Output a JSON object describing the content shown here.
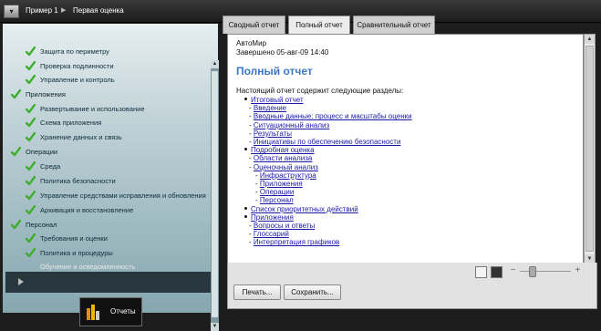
{
  "breadcrumb": {
    "menu_icon": "chevron-down-icon",
    "item1": "Пример 1",
    "item2": "Первая оценка",
    "sep": "▶"
  },
  "nav": {
    "items": [
      {
        "label": "Защита по периметру",
        "checked": true,
        "level": 2
      },
      {
        "label": "Проверка подлинности",
        "checked": true,
        "level": 2
      },
      {
        "label": "Управление и контроль",
        "checked": true,
        "level": 2
      },
      {
        "label": "Приложения",
        "checked": true,
        "level": 1
      },
      {
        "label": "Развертывание и использование",
        "checked": true,
        "level": 2
      },
      {
        "label": "Схема приложения",
        "checked": true,
        "level": 2
      },
      {
        "label": "Хранение данных и связь",
        "checked": true,
        "level": 2
      },
      {
        "label": "Операции",
        "checked": true,
        "level": 1
      },
      {
        "label": "Среда",
        "checked": true,
        "level": 2
      },
      {
        "label": "Политика безопасности",
        "checked": true,
        "level": 2
      },
      {
        "label": "Управление средствами исправления и обновления",
        "checked": true,
        "level": 2
      },
      {
        "label": "Архивация и восстановление",
        "checked": true,
        "level": 2
      },
      {
        "label": "Персонал",
        "checked": true,
        "level": 1
      },
      {
        "label": "Требования и оценки",
        "checked": true,
        "level": 2
      },
      {
        "label": "Политика и процедуры",
        "checked": true,
        "level": 2
      },
      {
        "label": "Обучение и осведомленность",
        "checked": false,
        "level": 2,
        "selected": true
      }
    ],
    "reports_button": "Отчеты"
  },
  "tabs": [
    "Сводный отчет",
    "Полный отчет",
    "Сравнительный отчет"
  ],
  "document": {
    "company": "АвтоМир",
    "completed": "Завершено 05-авг-09 14:40",
    "title": "Полный отчет",
    "intro": "Настоящий отчет содержит следующие разделы:",
    "toc": [
      {
        "text": "Итоговый отчет",
        "level": 1
      },
      {
        "text": "Введение",
        "level": 2
      },
      {
        "text": "Вводные данные: процесс и масштабы оценки",
        "level": 2
      },
      {
        "text": "Ситуационный анализ",
        "level": 2
      },
      {
        "text": "Результаты",
        "level": 2
      },
      {
        "text": "Инициативы по обеспечению безопасности",
        "level": 2
      },
      {
        "text": "Подробная оценка",
        "level": 1
      },
      {
        "text": "Области анализа",
        "level": 2
      },
      {
        "text": "Оценочный анализ",
        "level": 2
      },
      {
        "text": "Инфраструктура",
        "level": 3
      },
      {
        "text": "Приложения",
        "level": 3
      },
      {
        "text": "Операции",
        "level": 3
      },
      {
        "text": "Персонал",
        "level": 3
      },
      {
        "text": "Список приоритетных действий",
        "level": 1
      },
      {
        "text": "Приложения",
        "level": 1
      },
      {
        "text": "Вопросы и ответы",
        "level": 2
      },
      {
        "text": "Глоссарий",
        "level": 2
      },
      {
        "text": "Интерпретация графиков",
        "level": 2
      }
    ]
  },
  "toolbar": {
    "print_label": "Печать...",
    "save_label": "Сохранить...",
    "zoom_minus": "−",
    "zoom_plus": "+"
  },
  "colors": {
    "accent_title": "#3a78c4",
    "link": "#1a1aa8",
    "check": "#3cae2a"
  }
}
